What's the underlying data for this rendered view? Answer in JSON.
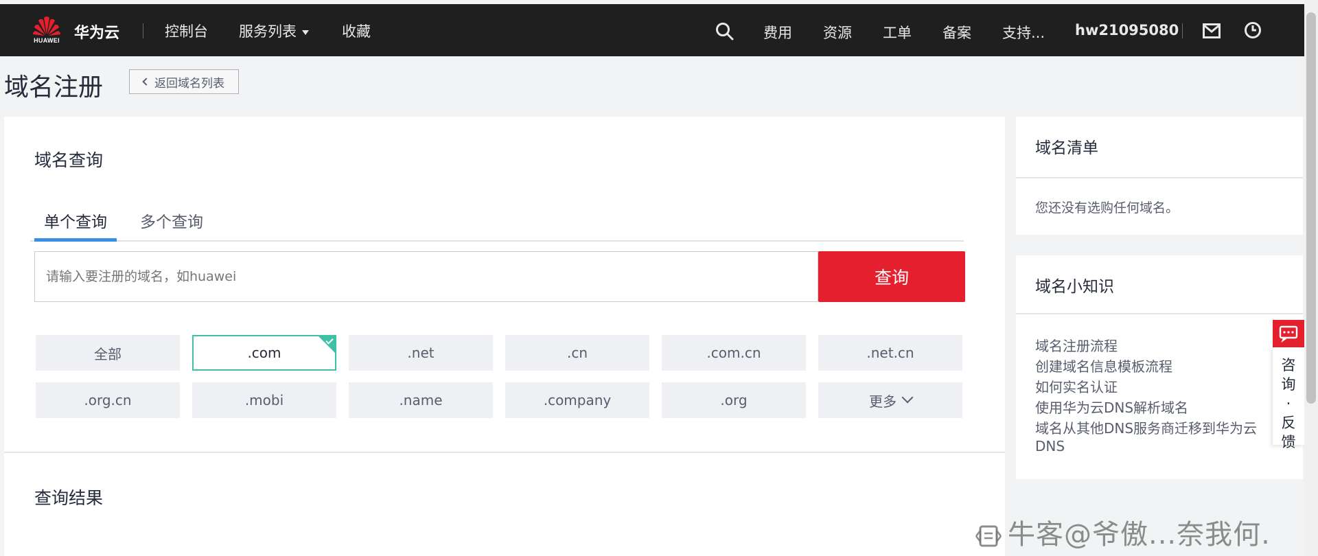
{
  "header": {
    "logo_text": "HUAWEI",
    "brand": "华为云",
    "nav_left": [
      {
        "label": "控制台"
      },
      {
        "label": "服务列表"
      },
      {
        "label": "收藏"
      }
    ],
    "nav_right": [
      {
        "label": "费用"
      },
      {
        "label": "资源"
      },
      {
        "label": "工单"
      },
      {
        "label": "备案"
      },
      {
        "label": "支持..."
      }
    ],
    "username": "hw21095080",
    "icons": [
      "search-icon",
      "mail-icon",
      "clock-icon"
    ]
  },
  "page": {
    "title": "域名注册",
    "back_label": "返回域名列表"
  },
  "query": {
    "section_title": "域名查询",
    "tabs": [
      {
        "label": "单个查询",
        "active": true
      },
      {
        "label": "多个查询",
        "active": false
      }
    ],
    "placeholder": "请输入要注册的域名，如huawei",
    "button_label": "查询",
    "tlds": [
      {
        "label": "全部",
        "selected": false
      },
      {
        "label": ".com",
        "selected": true
      },
      {
        "label": ".net",
        "selected": false
      },
      {
        "label": ".cn",
        "selected": false
      },
      {
        "label": ".com.cn",
        "selected": false
      },
      {
        "label": ".net.cn",
        "selected": false
      },
      {
        "label": ".org.cn",
        "selected": false
      },
      {
        "label": ".mobi",
        "selected": false
      },
      {
        "label": ".name",
        "selected": false
      },
      {
        "label": ".company",
        "selected": false
      },
      {
        "label": ".org",
        "selected": false
      },
      {
        "label": "更多",
        "selected": false
      }
    ],
    "results_title": "查询结果"
  },
  "sidebar": {
    "list_title": "域名清单",
    "list_empty": "您还没有选购任何域名。",
    "tips_title": "域名小知识",
    "tips": [
      "域名注册流程",
      "创建域名信息模板流程",
      "如何实名认证",
      "使用华为云DNS解析域名",
      "域名从其他DNS服务商迁移到华为云",
      "DNS"
    ]
  },
  "consult": {
    "label": "咨\n询\n·\n反\n馈"
  },
  "watermark": {
    "text": "牛客@爷傲...奈我何."
  },
  "colors": {
    "topbar": "#1f1f1f",
    "accent_red": "#e4202e",
    "tab_active": "#3a8ee6",
    "selected_border": "#3fbfa5"
  }
}
